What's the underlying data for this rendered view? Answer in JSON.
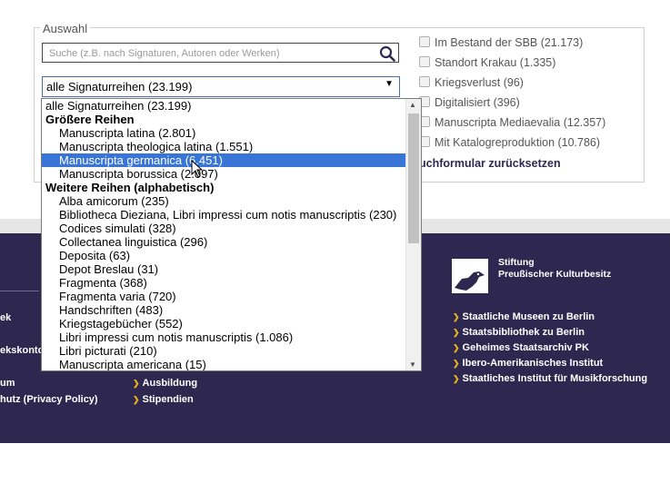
{
  "form": {
    "legend": "Auswahl",
    "search": {
      "placeholder": "Suche (z.B. nach Signaturen, Autoren oder Werken)",
      "value": ""
    },
    "select": {
      "selected": "alle Signaturreihen (23.199)"
    },
    "checkboxes": [
      {
        "label": "Im Bestand der SBB (21.173)",
        "checked": false
      },
      {
        "label": "Standort Krakau (1.335)",
        "checked": false
      },
      {
        "label": "Kriegsverlust (96)",
        "checked": false
      },
      {
        "label": "Digitalisiert (396)",
        "checked": false
      },
      {
        "label": "Manuscripta Mediaevalia (12.357)",
        "checked": false
      },
      {
        "label": "Mit Katalogreproduktion (10.786)",
        "checked": false
      }
    ],
    "reset_label": "uchformular zurücksetzen"
  },
  "dropdown": {
    "options": [
      {
        "text": "alle Signaturreihen (23.199)",
        "kind": "opt"
      },
      {
        "text": "Größere Reihen",
        "kind": "grp"
      },
      {
        "text": "Manuscripta latina (2.801)",
        "kind": "sub"
      },
      {
        "text": "Manuscripta theologica latina (1.551)",
        "kind": "sub"
      },
      {
        "text": "Manuscripta germanica (6.451)",
        "kind": "sub",
        "highlighted": true
      },
      {
        "text": "Manuscripta borussica (2.097)",
        "kind": "sub"
      },
      {
        "text": "Weitere Reihen (alphabetisch)",
        "kind": "grp"
      },
      {
        "text": "Alba amicorum (235)",
        "kind": "sub"
      },
      {
        "text": "Bibliotheca Dieziana, Libri impressi cum notis manuscriptis (230)",
        "kind": "sub"
      },
      {
        "text": "Codices simulati (328)",
        "kind": "sub"
      },
      {
        "text": "Collectanea linguistica (296)",
        "kind": "sub"
      },
      {
        "text": "Deposita (63)",
        "kind": "sub"
      },
      {
        "text": "Depot Breslau (31)",
        "kind": "sub"
      },
      {
        "text": "Fragmenta (368)",
        "kind": "sub"
      },
      {
        "text": "Fragmenta varia (720)",
        "kind": "sub"
      },
      {
        "text": "Handschriften (483)",
        "kind": "sub"
      },
      {
        "text": "Kriegstagebücher (552)",
        "kind": "sub"
      },
      {
        "text": "Libri impressi cum notis manuscriptis (1.086)",
        "kind": "sub"
      },
      {
        "text": "Libri picturati (210)",
        "kind": "sub"
      },
      {
        "text": "Manuscripta americana (15)",
        "kind": "sub"
      }
    ]
  },
  "footer": {
    "left_links": [
      "ek",
      "",
      "ekskonto",
      "um",
      "hutz (Privacy Policy)"
    ],
    "mid_links": [
      "Ausbildung",
      "Stipendien"
    ],
    "spk": {
      "line1": "Stiftung",
      "line2": "Preußischer Kulturbesitz"
    },
    "spk_links": [
      "Staatliche Museen zu Berlin",
      "Staatsbibliothek zu Berlin",
      "Geheimes Staatsarchiv PK",
      "Ibero-Amerikanisches Institut",
      "Staatliches Institut für Musikforschung"
    ]
  },
  "colors": {
    "footer_bg": "#2e2750",
    "bullet": "#e8b41a",
    "highlight": "#3875d7"
  }
}
